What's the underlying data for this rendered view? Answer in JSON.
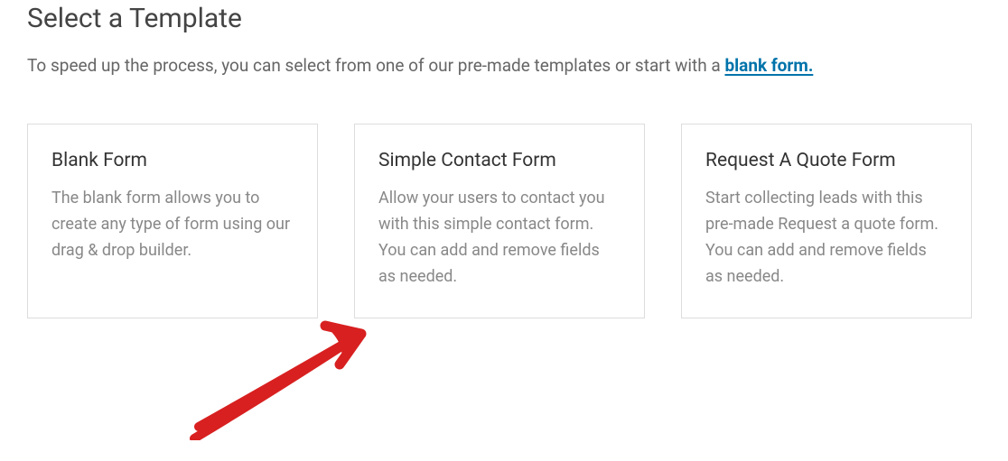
{
  "heading": "Select a Template",
  "intro_prefix": "To speed up the process, you can select from one of our pre-made templates or start with a ",
  "intro_link_label": "blank form.",
  "cards": [
    {
      "title": "Blank Form",
      "description": "The blank form allows you to create any type of form using our drag & drop builder."
    },
    {
      "title": "Simple Contact Form",
      "description": "Allow your users to contact you with this simple contact form. You can add and remove fields as needed."
    },
    {
      "title": "Request A Quote Form",
      "description": "Start collecting leads with this pre-made Request a quote form. You can add and remove fields as needed."
    }
  ]
}
